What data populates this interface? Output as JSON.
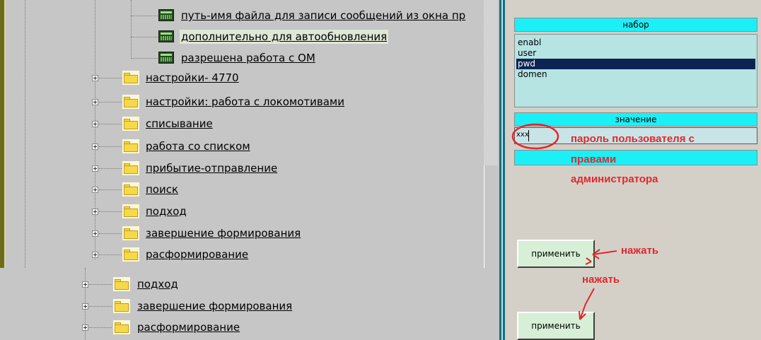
{
  "tree": {
    "items": [
      {
        "label": "путь-имя файла для записи сообщений из окна пр"
      },
      {
        "label": "дополнительно для автообновления"
      },
      {
        "label": "разрешена работа с ОМ"
      },
      {
        "label": "настройки- 4770"
      },
      {
        "label": "настройки: работа с локомотивами"
      },
      {
        "label": "списывание"
      },
      {
        "label": "работа со списком"
      },
      {
        "label": "прибытие-отправление"
      },
      {
        "label": "поиск"
      },
      {
        "label": "подход"
      },
      {
        "label": "завершение формирования"
      },
      {
        "label": "расформирование"
      }
    ],
    "items2": [
      {
        "label": "подход"
      },
      {
        "label": "завершение формирования"
      },
      {
        "label": "расформирование"
      }
    ]
  },
  "panel": {
    "set_header": "набор",
    "list_items": [
      "enabl",
      "user",
      "pwd",
      "domen"
    ],
    "selected_item": "pwd",
    "value_header": "значение",
    "value_text": "xxx",
    "apply_label": "применить"
  },
  "annotations": {
    "password_note_1": "пароль пользователя с",
    "password_note_2": "правами",
    "password_note_3": "администратора",
    "press_1": "нажать",
    "press_2": "нажать"
  },
  "colors": {
    "accent_cyan": "#1bf0f7",
    "selection": "#0b2452",
    "annotation_red": "#e0282d",
    "tree_bg": "#c6c6c6",
    "panel_bg": "#d4d0c8"
  }
}
